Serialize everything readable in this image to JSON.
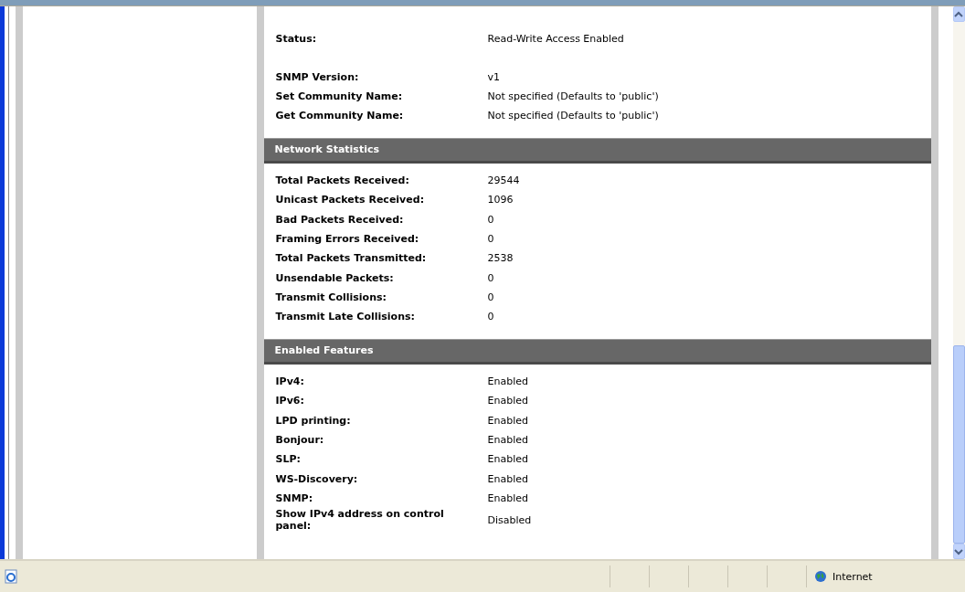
{
  "sections": [
    {
      "groups": [
        [
          {
            "label": "Status:",
            "value": "Read-Write Access Enabled"
          }
        ],
        [
          {
            "label": "SNMP Version:",
            "value": "v1"
          },
          {
            "label": "Set Community Name:",
            "value": "Not specified (Defaults to 'public')"
          },
          {
            "label": "Get Community Name:",
            "value": "Not specified (Defaults to 'public')"
          }
        ]
      ]
    },
    {
      "title": "Network Statistics",
      "groups": [
        [
          {
            "label": "Total Packets Received:",
            "value": "29544"
          },
          {
            "label": "Unicast Packets Received:",
            "value": "1096"
          },
          {
            "label": "Bad Packets Received:",
            "value": "0"
          },
          {
            "label": "Framing Errors Received:",
            "value": "0"
          },
          {
            "label": "Total Packets Transmitted:",
            "value": "2538"
          },
          {
            "label": "Unsendable Packets:",
            "value": "0"
          },
          {
            "label": "Transmit Collisions:",
            "value": "0"
          },
          {
            "label": "Transmit Late Collisions:",
            "value": "0"
          }
        ]
      ]
    },
    {
      "title": "Enabled Features",
      "groups": [
        [
          {
            "label": "IPv4:",
            "value": "Enabled"
          },
          {
            "label": "IPv6:",
            "value": "Enabled"
          },
          {
            "label": "LPD printing:",
            "value": "Enabled"
          },
          {
            "label": "Bonjour:",
            "value": "Enabled"
          },
          {
            "label": "SLP:",
            "value": "Enabled"
          },
          {
            "label": "WS-Discovery:",
            "value": "Enabled"
          },
          {
            "label": "SNMP:",
            "value": "Enabled"
          },
          {
            "label": "Show IPv4 address on control panel:",
            "value": "Disabled"
          }
        ]
      ]
    }
  ],
  "status_bar": {
    "zone": "Internet"
  }
}
